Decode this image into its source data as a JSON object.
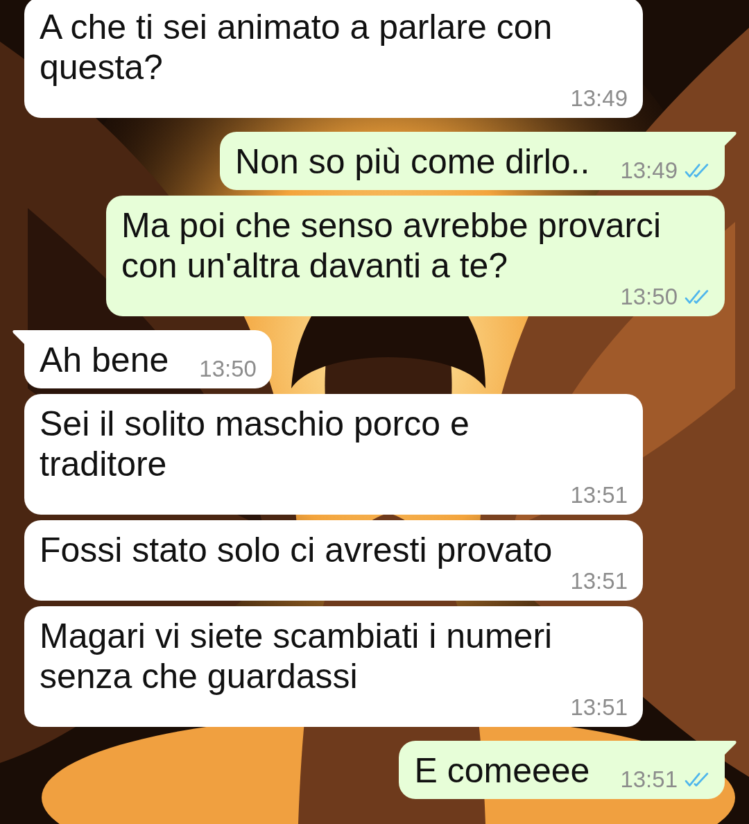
{
  "messages": [
    {
      "kind": "incoming",
      "tail": false,
      "text": "A che ti sei animato a parlare con questa?",
      "time": "13:49"
    },
    {
      "kind": "outgoing",
      "tail": true,
      "text": "Non so più come dirlo..",
      "time": "13:49",
      "read": true
    },
    {
      "kind": "outgoing",
      "tail": false,
      "text": "Ma poi che senso avrebbe provarci con un'altra davanti a te?",
      "time": "13:50",
      "read": true
    },
    {
      "kind": "incoming",
      "tail": true,
      "text": "Ah bene",
      "time": "13:50"
    },
    {
      "kind": "incoming",
      "tail": false,
      "text": "Sei il solito maschio porco e traditore",
      "time": "13:51"
    },
    {
      "kind": "incoming",
      "tail": false,
      "text": "Fossi stato solo ci avresti provato",
      "time": "13:51"
    },
    {
      "kind": "incoming",
      "tail": false,
      "text": "Magari vi siete scambiati i numeri senza che guardassi",
      "time": "13:51"
    },
    {
      "kind": "outgoing",
      "tail": true,
      "text": "E comeeee",
      "time": "13:51",
      "read": true
    }
  ]
}
